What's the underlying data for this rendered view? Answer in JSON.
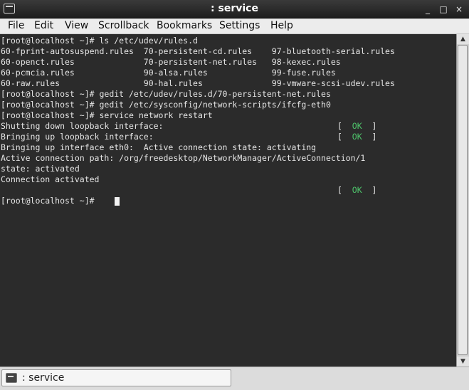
{
  "window": {
    "title": ": service",
    "controls": {
      "minimize": "_",
      "maximize": "□",
      "close": "×"
    }
  },
  "menubar": {
    "items": [
      {
        "label": "File"
      },
      {
        "label": "Edit"
      },
      {
        "label": "View"
      },
      {
        "label": "Scrollback"
      },
      {
        "label": "Bookmarks"
      },
      {
        "label": "Settings"
      },
      {
        "label": "Help"
      }
    ]
  },
  "terminal": {
    "lines": [
      "[root@localhost ~]# ls /etc/udev/rules.d",
      "60-fprint-autosuspend.rules  70-persistent-cd.rules    97-bluetooth-serial.rules",
      "60-openct.rules              70-persistent-net.rules   98-kexec.rules",
      "60-pcmcia.rules              90-alsa.rules             99-fuse.rules",
      "60-raw.rules                 90-hal.rules              99-vmware-scsi-udev.rules",
      "[root@localhost ~]# gedit /etc/udev/rules.d/70-persistent-net.rules",
      "[root@localhost ~]# gedit /etc/sysconfig/network-scripts/ifcfg-eth0",
      "[root@localhost ~]# service network restart",
      "Shutting down loopback interface:",
      "Bringing up loopback interface:",
      "Bringing up interface eth0:  Active connection state: activating",
      "Active connection path: /org/freedesktop/NetworkManager/ActiveConnection/1",
      "state: activated",
      "Connection activated",
      "",
      "[root@localhost ~]# "
    ],
    "status_ok": {
      "open": "[  ",
      "text": "OK",
      "close": "  ]"
    }
  },
  "taskbar": {
    "task_label": ": service"
  }
}
